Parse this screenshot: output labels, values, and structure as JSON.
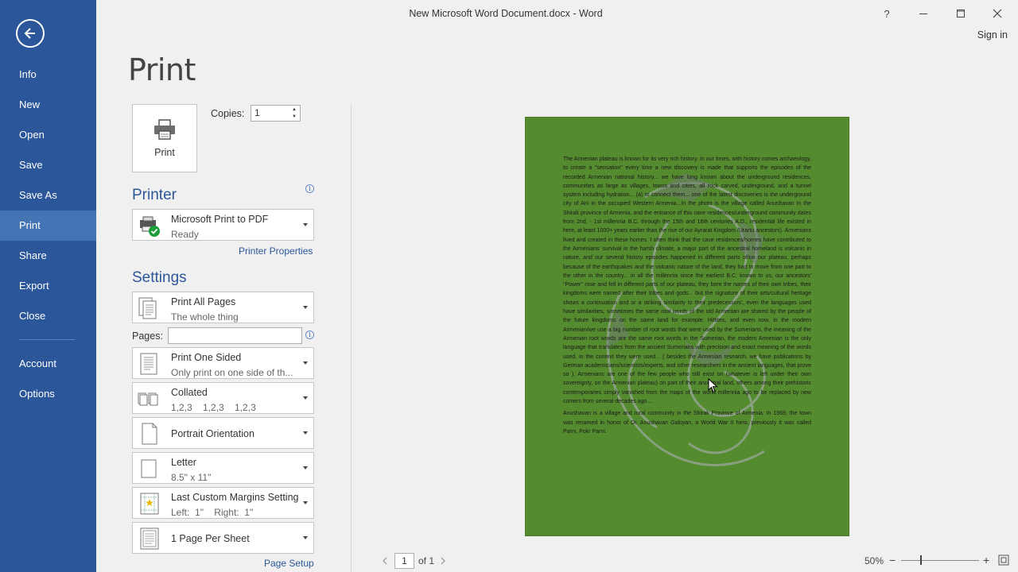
{
  "window": {
    "title": "New Microsoft Word Document.docx - Word",
    "help": "?",
    "sign_in": "Sign in"
  },
  "nav": {
    "items": [
      "Info",
      "New",
      "Open",
      "Save",
      "Save As",
      "Print",
      "Share",
      "Export",
      "Close",
      "Account",
      "Options"
    ],
    "active": "Print"
  },
  "print": {
    "heading": "Print",
    "button_label": "Print",
    "copies_label": "Copies:",
    "copies_value": "1"
  },
  "printer": {
    "heading": "Printer",
    "name": "Microsoft Print to PDF",
    "status": "Ready",
    "properties_link": "Printer Properties"
  },
  "settings": {
    "heading": "Settings",
    "pages_label": "Pages:",
    "pages_value": "",
    "print_range": {
      "title": "Print All Pages",
      "subtitle": "The whole thing"
    },
    "sides": {
      "title": "Print One Sided",
      "subtitle": "Only print on one side of th..."
    },
    "collation": {
      "title": "Collated",
      "subtitle": "1,2,3    1,2,3    1,2,3"
    },
    "orientation": {
      "title": "Portrait Orientation"
    },
    "paper": {
      "title": "Letter",
      "subtitle": "8.5\" x 11\""
    },
    "margins": {
      "title": "Last Custom Margins Setting",
      "subtitle": "Left:  1\"    Right:  1\""
    },
    "pages_per_sheet": {
      "title": "1 Page Per Sheet"
    },
    "page_setup_link": "Page Setup"
  },
  "preview": {
    "page_color": "#558b2f",
    "paragraph1": "The Armenian plateau is known for its very rich history. In our times, with history comes archaeology, to create a \"sensation\" every time a new discovery is made that supports the episodes of the recorded Armenian national history... we have long known about the underground residences, communities as large as villages, towns and cities, all rock carved, underground, and a tunnel system including hydration... (a) to connect them... one of the latest discoveries is the underground city of Ani in the occupied Western Armenia...In the photo is the village called Anushavan in the Shirak province of Armenia, and the entrance of this cave residences/underground community dates from 2nd, - 1st millennia B.C. through the 15th and 16th centuries A.D., residential life existed in here, at least 1000+ years earlier than the rise of our Ayrarat Kingdom /Urartu ancestors). Armenians lived and created in these homes. I often think that the cave residences/homes have contributed to the Armenians' survival in the harsh climate, a major part of the ancestral homeland is volcanic in nature, and our several history episodes happened in different parts of/on our plateau, perhaps because of the earthquakes and the volcanic nature of the land, they had to move from one part to the other in the country... in all the millennia since the earliest B.C. known to us, our ancestors' \"Power\" rose and fell in different parts of our plateau, they bore the names of their own tribes, their kingdoms were named after their tribes and gods... but the signature of their arts/cultural heritage shows a continuation and or a striking similarity to their predecessors', even the languages used have similarities, sometimes the same root words of the old Armenian are shared by the people of the future kingdoms on the same land for example: Hittites, and even now, in the modern Armenian/we use a big number of root words that were used by the Sumerians, the meaning of the Armenian root words are the same root words in the Sumerian, the modern Armenian is the only language that translates from the ancient Sumerians with precision and exact meaning of the words used, in the context they were used... ( besides the Armenian research, we have publications by German academicians/scientists/experts, and other researchers in the ancient languages, that prove so ). Armenians are one of the few people who still exist on (whatever is left under their own sovereignty, on the Armenian plateau) on part of their ancestral land, others among their prehistoric contemporaries simply vanished from the maps of the world millennia ago to be replaced by new comers from several decades ago....",
    "paragraph2": "Anushavan is a village and rural community in the Shirak Province of Armenia. In 1969, the town was renamed in honor of Dr. Anushavan Galoyan, a World War II hero, previously it was called Parni, Pokr Parni."
  },
  "footer": {
    "page_value": "1",
    "page_of": "of 1",
    "zoom": "50%",
    "zoom_minus": "−",
    "zoom_plus": "+"
  }
}
